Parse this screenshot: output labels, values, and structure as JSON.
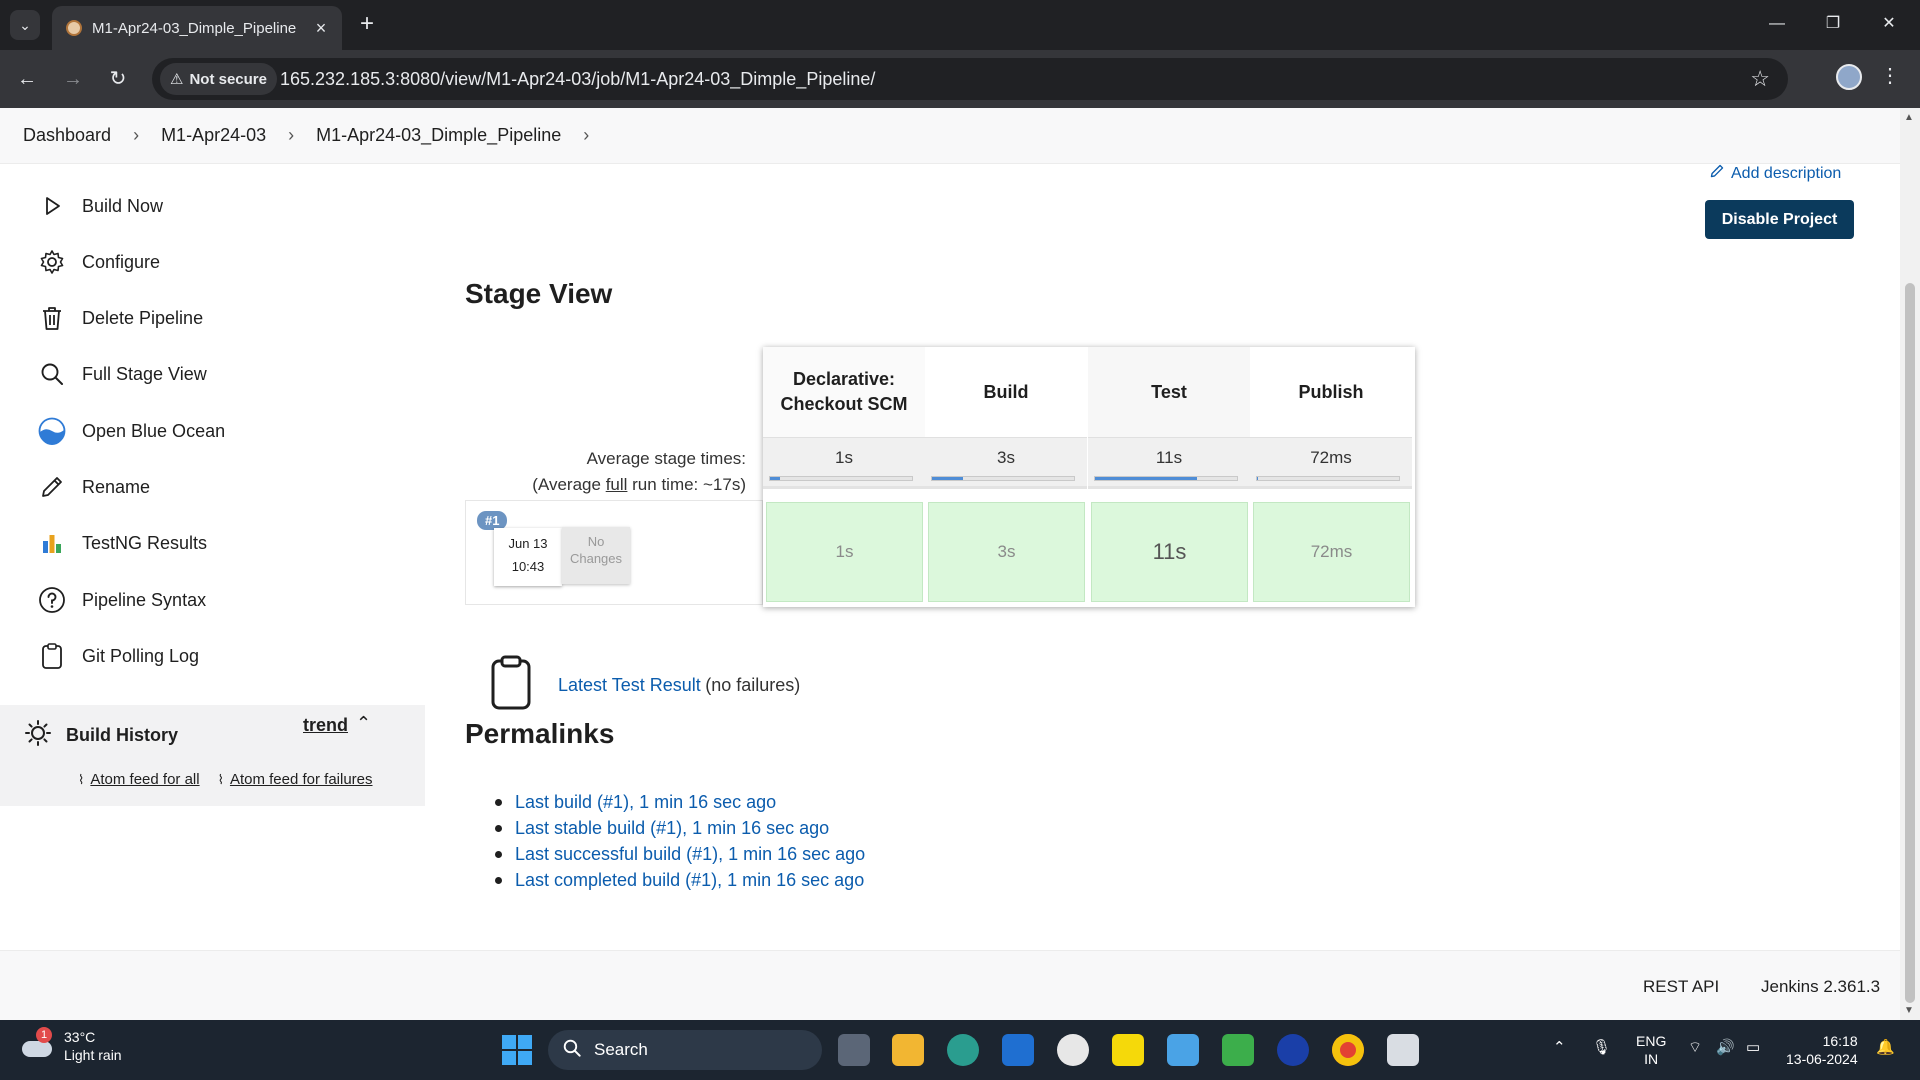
{
  "browser": {
    "tab_title": "M1-Apr24-03_Dimple_Pipeline",
    "security_label": "Not secure",
    "url": "165.232.185.3:8080/view/M1-Apr24-03/job/M1-Apr24-03_Dimple_Pipeline/"
  },
  "breadcrumbs": [
    "Dashboard",
    "M1-Apr24-03",
    "M1-Apr24-03_Dimple_Pipeline"
  ],
  "sidebar": {
    "items": [
      {
        "label": "Build Now",
        "icon": "play-icon"
      },
      {
        "label": "Configure",
        "icon": "gear-icon"
      },
      {
        "label": "Delete Pipeline",
        "icon": "trash-icon"
      },
      {
        "label": "Full Stage View",
        "icon": "search-icon"
      },
      {
        "label": "Open Blue Ocean",
        "icon": "blue-ocean-icon"
      },
      {
        "label": "Rename",
        "icon": "pencil-icon"
      },
      {
        "label": "TestNG Results",
        "icon": "testng-icon"
      },
      {
        "label": "Pipeline Syntax",
        "icon": "help-icon"
      },
      {
        "label": "Git Polling Log",
        "icon": "clipboard-icon"
      }
    ],
    "build_history": {
      "title": "Build History",
      "trend": "trend",
      "feed_all": "Atom feed for all",
      "feed_failures": "Atom feed for failures"
    }
  },
  "main": {
    "add_description": "Add description",
    "disable_button": "Disable Project",
    "stage_view_title": "Stage View",
    "avg_stage_times_label": "Average stage times:",
    "avg_run_time_prefix": "(Average ",
    "avg_run_time_full": "full",
    "avg_run_time_suffix": " run time: ~17s)",
    "stages": [
      {
        "name": "Declarative: Checkout SCM",
        "avg": "1s",
        "avg_fraction": 0.07,
        "run": "1s"
      },
      {
        "name": "Build",
        "avg": "3s",
        "avg_fraction": 0.22,
        "run": "3s"
      },
      {
        "name": "Test",
        "avg": "11s",
        "avg_fraction": 0.72,
        "run": "11s"
      },
      {
        "name": "Publish",
        "avg": "72ms",
        "avg_fraction": 0.01,
        "run": "72ms"
      }
    ],
    "run": {
      "badge": "#1",
      "date": "Jun 13",
      "time": "10:43",
      "changes": "No Changes"
    },
    "latest_test_result_link": "Latest Test Result",
    "latest_test_result_note": "(no failures)",
    "permalinks_title": "Permalinks",
    "permalinks": [
      "Last build (#1), 1 min 16 sec ago",
      "Last stable build (#1), 1 min 16 sec ago",
      "Last successful build (#1), 1 min 16 sec ago",
      "Last completed build (#1), 1 min 16 sec ago"
    ]
  },
  "footer": {
    "rest_api": "REST API",
    "version": "Jenkins 2.361.3"
  },
  "taskbar": {
    "weather_temp": "33°C",
    "weather_desc": "Light rain",
    "weather_badge": "1",
    "search": "Search",
    "lang": "ENG",
    "region": "IN",
    "time": "16:18",
    "date": "13-06-2024"
  }
}
